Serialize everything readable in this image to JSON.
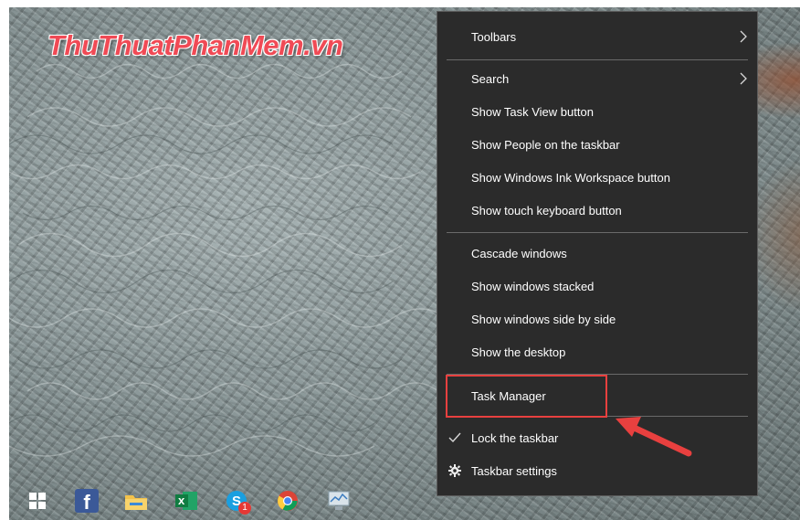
{
  "watermark": "ThuThuatPhanMem.vn",
  "menu": {
    "items": [
      {
        "label": "Toolbars"
      },
      {
        "label": "Search"
      },
      {
        "label": "Show Task View button"
      },
      {
        "label": "Show People on the taskbar"
      },
      {
        "label": "Show Windows Ink Workspace button"
      },
      {
        "label": "Show touch keyboard button"
      },
      {
        "label": "Cascade windows"
      },
      {
        "label": "Show windows stacked"
      },
      {
        "label": "Show windows side by side"
      },
      {
        "label": "Show the desktop"
      },
      {
        "label": "Task Manager"
      },
      {
        "label": "Lock the taskbar"
      },
      {
        "label": "Taskbar settings"
      }
    ]
  },
  "taskbar": {
    "icons": [
      "start-icon",
      "facebook-icon",
      "file-explorer-icon",
      "excel-icon",
      "skype-icon",
      "chrome-icon",
      "performance-monitor-icon"
    ],
    "skype_badge": "1",
    "excel_letter": "x",
    "facebook_letter": "f"
  },
  "colors": {
    "menu_bg": "#2b2b2b",
    "highlight": "#e8403f",
    "watermark": "#f04a55"
  }
}
